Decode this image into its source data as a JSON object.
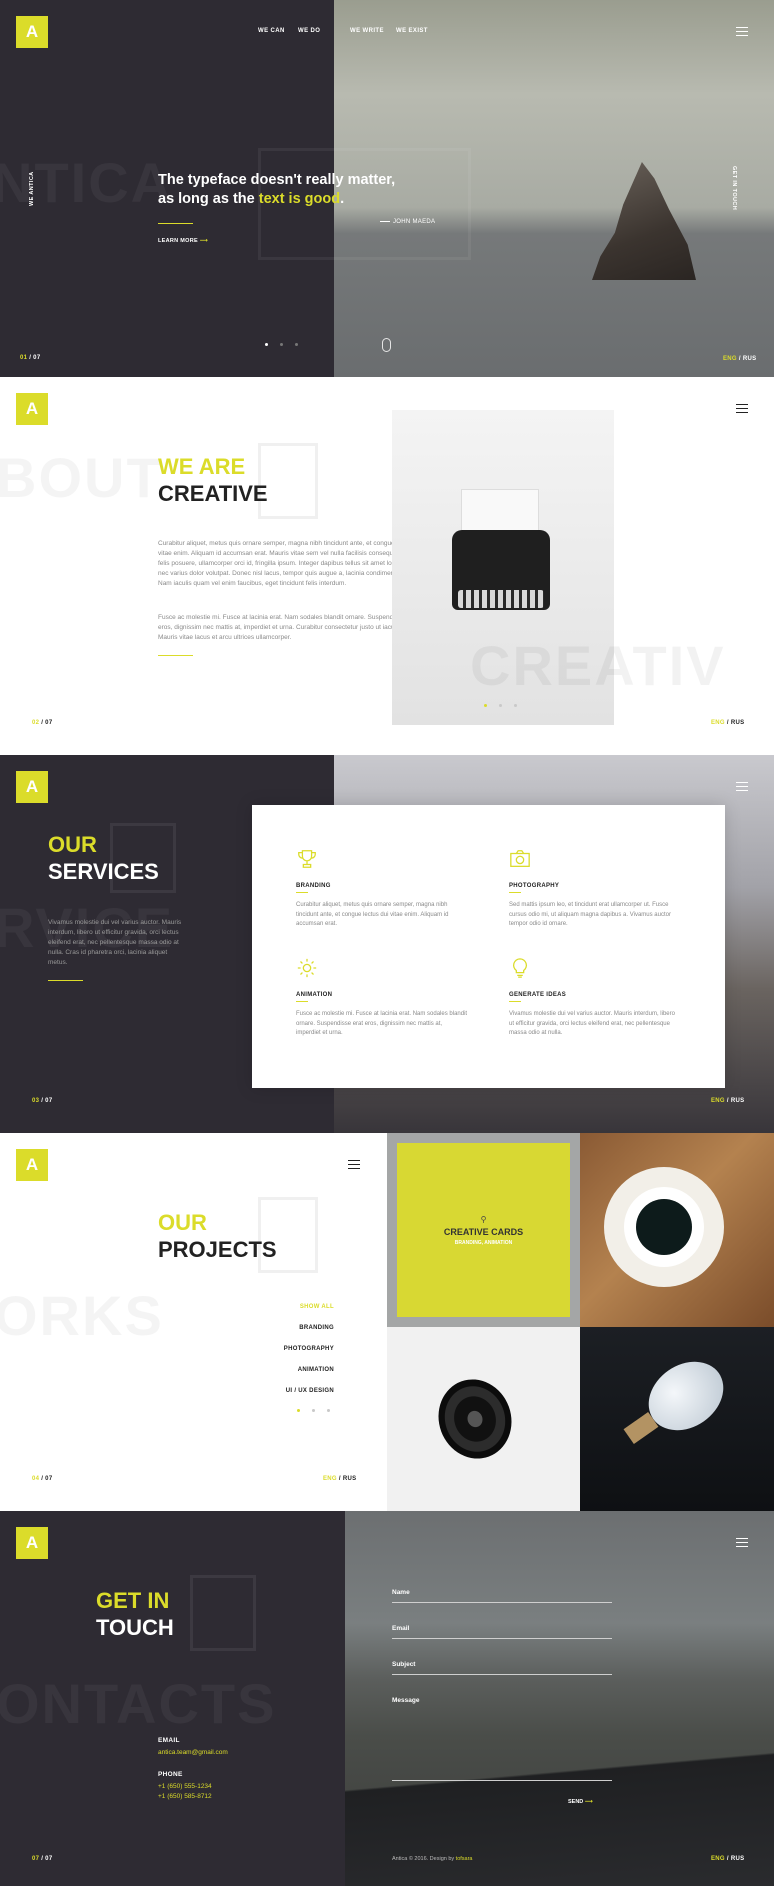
{
  "brand": {
    "logo_letter": "A",
    "accent": "#dbdc2a",
    "dark": "#2e2b33"
  },
  "lang": {
    "active": "ENG",
    "sep": " / ",
    "other": "RUS"
  },
  "hero": {
    "nav": [
      "WE CAN",
      "WE DO",
      "WE WRITE",
      "WE EXIST"
    ],
    "ghost": "NTICA",
    "side_left": "WE ANTICA",
    "side_right": "GET IN TOUCH",
    "quote_a": "The typeface doesn't really matter,",
    "quote_b": "as long as the ",
    "quote_hl": "text is good",
    "quote_end": ".",
    "author": "JOHN MAEDA",
    "learn_more": "LEARN MORE",
    "pager_cur": "01",
    "pager_total": " / 07"
  },
  "about": {
    "title_a": "WE ARE",
    "title_b": "CREATIVE",
    "ghost_a": "BOUT",
    "ghost_b": "CREATIV",
    "para1": "Curabitur aliquet, metus quis ornare semper, magna nibh tincidunt ante, et congue lectus dui vitae enim. Aliquam id accumsan erat. Mauris vitae sem vel nulla facilisis consequat. Sed sed felis posuere, ullamcorper orci id, fringilla ipsum. Integer dapibus tellus sit amet lorem efficitur, nec varius dolor volutpat. Donec nisl lacus, tempor quis augue a, lacinia condimentum diam. Nam iaculis quam vel enim faucibus, eget tincidunt felis interdum.",
    "para2": "Fusce ac molestie mi. Fusce at lacinia erat. Nam sodales blandit ornare. Suspendisse erat eros, dignissim nec mattis at, imperdiet et urna. Curabitur consectetur justo ut iaculis tempor. Mauris vitae lacus et arcu ultrices ullamcorper.",
    "pager_cur": "02",
    "pager_total": " / 07"
  },
  "services": {
    "title_a": "OUR",
    "title_b": "SERVICES",
    "ghost": "RVICE",
    "intro": "Vivamus molestie dui vel varius auctor. Mauris interdum, libero ut efficitur gravida, orci lectus eleifend erat, nec pellentesque massa odio at nulla. Cras id pharetra orci, lacinia aliquet metus.",
    "items": [
      {
        "name": "BRANDING",
        "icon": "trophy-icon",
        "text": "Curabitur aliquet, metus quis ornare semper, magna nibh tincidunt ante, et congue lectus dui vitae enim. Aliquam id accumsan erat."
      },
      {
        "name": "PHOTOGRAPHY",
        "icon": "camera-icon",
        "text": "Sed mattis ipsum leo, et tincidunt erat ullamcorper ut. Fusce cursus odio mi, ut aliquam magna dapibus a. Vivamus auctor tempor odio id ornare."
      },
      {
        "name": "ANIMATION",
        "icon": "gear-icon",
        "text": "Fusce ac molestie mi. Fusce at lacinia erat. Nam sodales blandit ornare. Suspendisse erat eros, dignissim nec mattis at, imperdiet et urna."
      },
      {
        "name": "GENERATE IDEAS",
        "icon": "lightbulb-icon",
        "text": "Vivamus molestie dui vel varius auctor. Mauris interdum, libero ut efficitur gravida, orci lectus eleifend erat, nec pellentesque massa odio at nulla."
      }
    ],
    "pager_cur": "03",
    "pager_total": " / 07"
  },
  "projects": {
    "title_a": "OUR",
    "title_b": "PROJECTS",
    "ghost": "ORKS",
    "filters": [
      "SHOW ALL",
      "BRANDING",
      "PHOTOGRAPHY",
      "ANIMATION",
      "UI / UX DESIGN"
    ],
    "featured_title": "CREATIVE CARDS",
    "featured_tags": "BRANDING, ANIMATION",
    "pager_cur": "04",
    "pager_total": " / 07"
  },
  "contact": {
    "title_a": "GET IN",
    "title_b": "TOUCH",
    "ghost": "ONTACTS",
    "email_label": "EMAIL",
    "email": "antica.team@gmail.com",
    "phone_label": "PHONE",
    "phone1": "+1 (650) 555-1234",
    "phone2": "+1 (650) 585-8712",
    "fields": [
      "Name",
      "Email",
      "Subject",
      "Message"
    ],
    "send": "SEND",
    "footer_a": "Antica © 2016. Design by ",
    "footer_b": "tofsara",
    "pager_cur": "07",
    "pager_total": " / 07"
  }
}
